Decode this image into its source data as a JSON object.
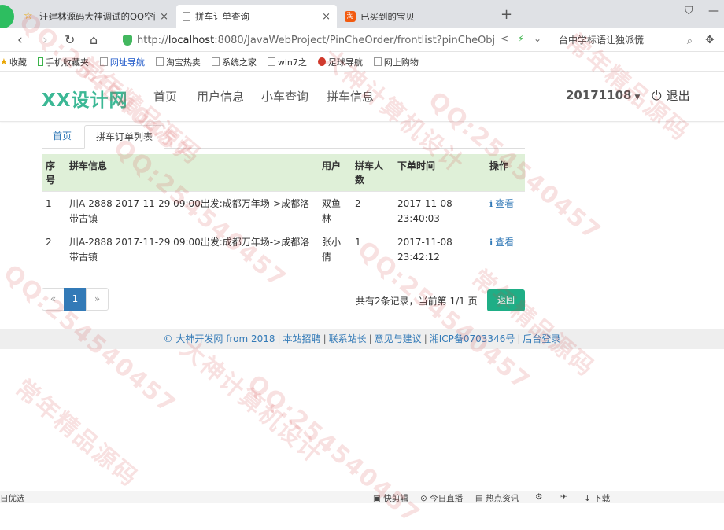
{
  "browser": {
    "tabs": [
      {
        "title": "汪建林源码大神调试的QQ空间",
        "icon": "star-icon",
        "active": false
      },
      {
        "title": "拼车订单查询",
        "icon": "page-icon",
        "active": true
      },
      {
        "title": "已买到的宝贝",
        "icon": "taobao-icon",
        "active": false
      }
    ],
    "close_glyph": "×",
    "new_tab_glyph": "+",
    "address": {
      "prefix": "http://",
      "host": "localhost",
      "path": ":8080/JavaWebProject/PinCheOrder/frontlist?pinCheObj"
    },
    "search_text": "台中学标语让独派慌",
    "bookmarks": [
      {
        "label": "收藏",
        "icon": "star-icon"
      },
      {
        "label": "手机收藏夹",
        "icon": "phone-icon"
      },
      {
        "label": "网址导航",
        "icon": "page-icon",
        "color": "#1a55c8"
      },
      {
        "label": "淘宝热卖",
        "icon": "page-icon"
      },
      {
        "label": "系统之家",
        "icon": "page-icon"
      },
      {
        "label": "win7之",
        "icon": "page-icon"
      },
      {
        "label": "足球导航",
        "icon": "football-icon"
      },
      {
        "label": "网上购物",
        "icon": "page-icon"
      }
    ],
    "status_left": "日优选",
    "status_items": [
      "快剪辑",
      "今日直播",
      "热点资讯",
      "下载"
    ]
  },
  "site": {
    "brand": "XX设计网",
    "brand_color": "#3cb895",
    "nav": [
      "首页",
      "用户信息",
      "小车查询",
      "拼车信息"
    ],
    "user": "20171108",
    "logout": "退出"
  },
  "subtabs": [
    "首页",
    "拼车订单列表"
  ],
  "table": {
    "headers": [
      "序号",
      "拼车信息",
      "用户",
      "拼车人数",
      "下单时间",
      "操作"
    ],
    "rows": [
      {
        "no": "1",
        "info": "川A-2888 2017-11-29 09:00出发:成都万年场->成都洛带古镇",
        "user": "双鱼林",
        "count": "2",
        "time": "2017-11-08 23:40:03",
        "action": "查看"
      },
      {
        "no": "2",
        "info": "川A-2888 2017-11-29 09:00出发:成都万年场->成都洛带古镇",
        "user": "张小倩",
        "count": "1",
        "time": "2017-11-08 23:42:12",
        "action": "查看"
      }
    ],
    "header_bg": "#dff0d8"
  },
  "pagination": {
    "prev": "«",
    "current": "1",
    "next": "»",
    "summary": "共有2条记录，当前第 1/1 页",
    "back_button": "返回",
    "back_color": "#1fae86"
  },
  "footer": {
    "links": [
      "© 大神开发网 from 2018",
      "本站招聘",
      "联系站长",
      "意见与建议",
      "湘ICP备0703346号",
      "后台登录"
    ],
    "separator": "|"
  },
  "watermark": {
    "lines": [
      "QQ:254540457",
      "大神计算机设计",
      "常年精品源码"
    ]
  }
}
